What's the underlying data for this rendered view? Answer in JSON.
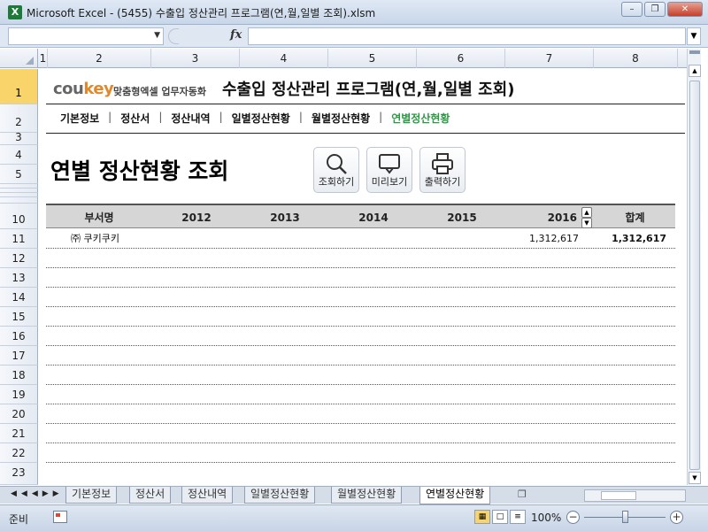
{
  "window": {
    "title": "Microsoft Excel - (5455) 수출입 정산관리 프로그램(연,월,일별 조회).xlsm",
    "app_icon": "X"
  },
  "formula_bar": {
    "fx_label": "fx",
    "name_box": "",
    "formula": ""
  },
  "columns": [
    "1",
    "2",
    "3",
    "4",
    "5",
    "6",
    "7",
    "8"
  ],
  "rows": [
    "1",
    "2",
    "3",
    "4",
    "5",
    "10",
    "11",
    "12",
    "13",
    "14",
    "15",
    "16",
    "17",
    "18",
    "19",
    "20",
    "21",
    "22",
    "23"
  ],
  "active_row": "1",
  "brand": {
    "name_a": "cou",
    "name_b": "key",
    "slogan": "맞춤형엑셀 업무자동화"
  },
  "app_title": "수출입 정산관리 프로그램(연,월,일별 조회)",
  "nav": [
    {
      "label": "기본정보",
      "active": false
    },
    {
      "label": "정산서",
      "active": false
    },
    {
      "label": "정산내역",
      "active": false
    },
    {
      "label": "일별정산현황",
      "active": false
    },
    {
      "label": "월별정산현황",
      "active": false
    },
    {
      "label": "연별정산현황",
      "active": true
    }
  ],
  "nav_separator": "|",
  "page_title": "연별 정산현황 조회",
  "toolbar": {
    "search_label": "조회하기",
    "preview_label": "미리보기",
    "print_label": "출력하기"
  },
  "table": {
    "headers": [
      "부서명",
      "2012",
      "2013",
      "2014",
      "2015",
      "2016",
      "합계"
    ],
    "rows": [
      {
        "dept": "㈜ 쿠키쿠키",
        "y2012": "",
        "y2013": "",
        "y2014": "",
        "y2015": "",
        "y2016": "1,312,617",
        "total": "1,312,617"
      }
    ],
    "empty_rows": 12
  },
  "sheet_tabs": [
    {
      "label": "기본정보",
      "active": false
    },
    {
      "label": "정산서",
      "active": false
    },
    {
      "label": "정산내역",
      "active": false
    },
    {
      "label": "일별정산현황",
      "active": false
    },
    {
      "label": "월별정산현황",
      "active": false
    },
    {
      "label": "연별정산현황",
      "active": true
    }
  ],
  "status": {
    "ready": "준비",
    "zoom": "100%"
  },
  "colors": {
    "accent_green": "#2b9a45",
    "brand_orange": "#e0882c",
    "header_gray": "#d6d6d6"
  }
}
